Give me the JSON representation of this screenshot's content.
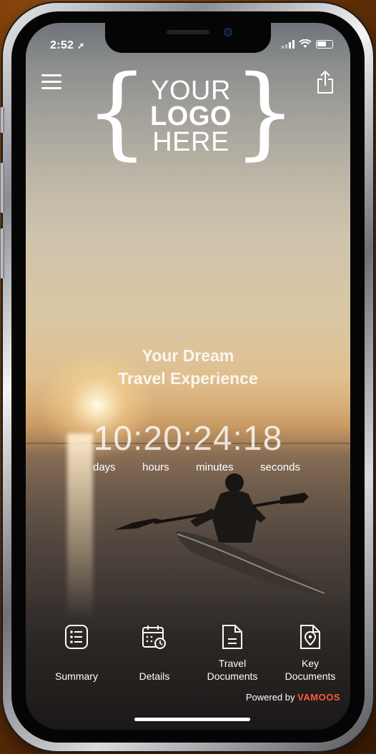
{
  "status_bar": {
    "time": "2:52",
    "location_arrow": "location-arrow-icon",
    "signal": "signal-icon",
    "wifi": "wifi-icon",
    "battery": "battery-icon"
  },
  "header": {
    "menu_icon": "hamburger-menu-icon",
    "share_icon": "share-icon",
    "logo": {
      "line1": "YOUR",
      "line2": "LOGO",
      "line3": "HERE"
    }
  },
  "hero": {
    "headline_line1": "Your Dream",
    "headline_line2": "Travel Experience"
  },
  "countdown": {
    "value": "10:20:24:18",
    "labels": {
      "days": "days",
      "hours": "hours",
      "minutes": "minutes",
      "seconds": "seconds"
    }
  },
  "tabs": [
    {
      "label": "Summary",
      "icon": "list-icon"
    },
    {
      "label": "Details",
      "icon": "calendar-clock-icon"
    },
    {
      "label": "Travel Documents",
      "label_line1": "Travel",
      "label_line2": "Documents",
      "icon": "document-icon"
    },
    {
      "label": "Key Documents",
      "label_line1": "Key",
      "label_line2": "Documents",
      "icon": "document-pin-icon"
    }
  ],
  "footer": {
    "powered_prefix": "Powered by",
    "brand": "VAMOOS",
    "brand_color": "#ff5a3c"
  }
}
